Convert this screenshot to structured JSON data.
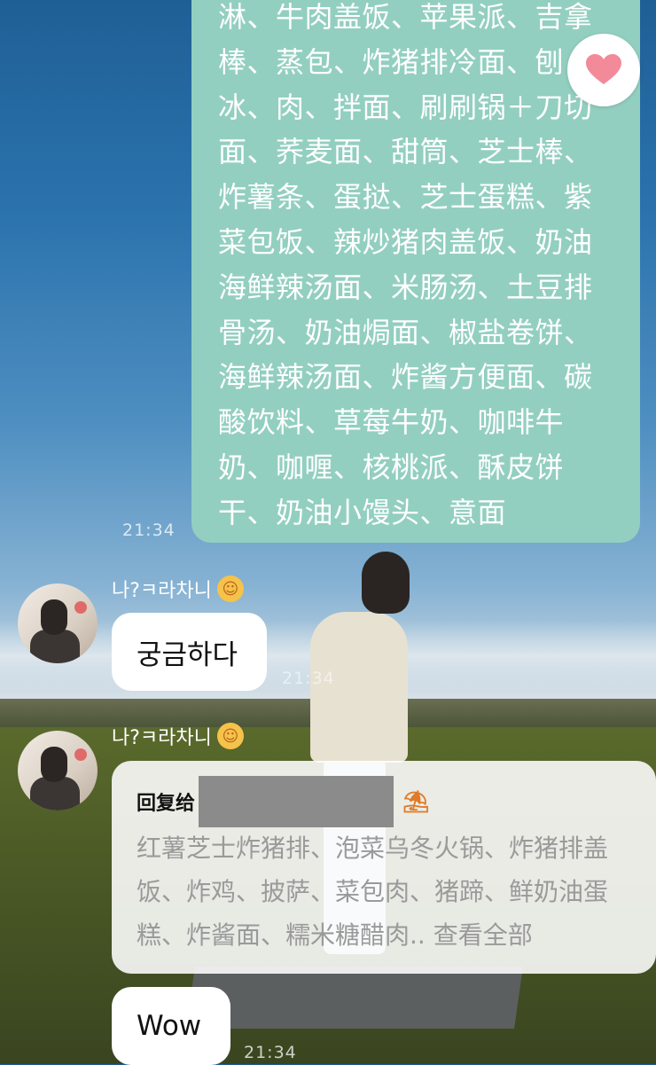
{
  "messages": {
    "top_bubble_text": "淋、牛肉盖饭、苹果派、吉拿棒、蒸包、炸猪排冷面、刨冰、肉、拌面、刷刷锅＋刀切面、荞麦面、甜筒、芝士棒、炸薯条、蛋挞、芝士蛋糕、紫菜包饭、辣炒猪肉盖饭、奶油海鲜辣汤面、米肠汤、土豆排骨汤、奶油焗面、椒盐卷饼、海鲜辣汤面、炸酱方便面、碳酸饮料、草莓牛奶、咖啡牛奶、咖喱、核桃派、酥皮饼干、奶油小馒头、意面",
    "time1": "21:34",
    "sender1": "나?ㅋ라차니",
    "msg1": "궁금하다",
    "time2": "21:34",
    "sender2": "나?ㅋ라차니",
    "reply_label": "回复给",
    "reply_text": "红薯芝士炸猪排、泡菜乌冬火锅、炸猪排盖饭、炸鸡、披萨、菜包肉、猪蹄、鲜奶油蛋糕、炸酱面、糯米糖醋肉.. 查看全部",
    "msg2": "Wow",
    "time3": "21:34"
  },
  "colors": {
    "bubble_mint": "#93cfc0",
    "heart": "#f28a9a"
  },
  "icons": {
    "reaction": "heart-icon",
    "emoji": "hugging-face-emoji",
    "reply_emoji": "beach-umbrella-emoji"
  }
}
